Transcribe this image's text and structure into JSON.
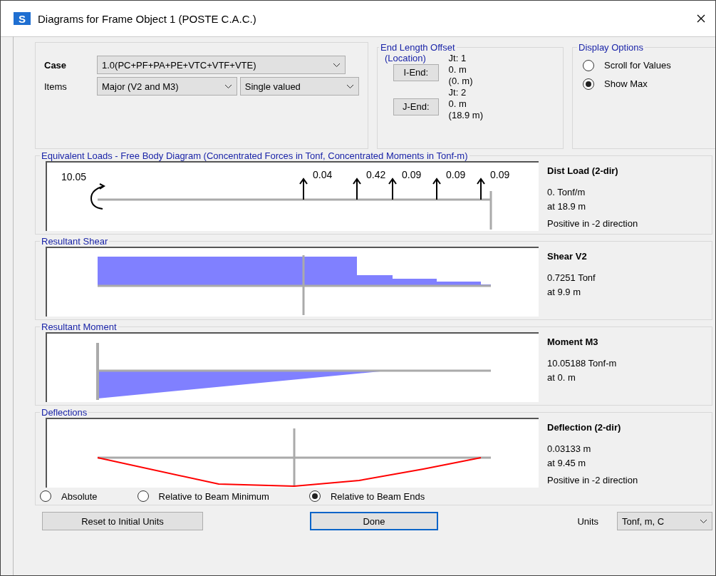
{
  "window": {
    "icon_letter": "S",
    "title": "Diagrams for Frame Object 1  (POSTE C.A.C.)"
  },
  "case_group": {
    "case_label": "Case",
    "case_value": "1.0(PC+PF+PA+PE+VTC+VTF+VTE)",
    "items_label": "Items",
    "items_value": "Major (V2 and M3)",
    "items_mode": "Single valued"
  },
  "end_offset": {
    "title": "End Length Offset",
    "subtitle": "(Location)",
    "ends": [
      {
        "button": "I-End:",
        "joint": "Jt:  1",
        "offset": "0. m",
        "location": "(0. m)"
      },
      {
        "button": "J-End:",
        "joint": "Jt:  2",
        "offset": "0. m",
        "location": "(18.9 m)"
      }
    ]
  },
  "display_options": {
    "title": "Display Options",
    "options": [
      {
        "label": "Scroll for Values",
        "selected": false
      },
      {
        "label": "Show Max",
        "selected": true
      }
    ]
  },
  "diagrams": [
    {
      "kind": "fbd",
      "title": "Equivalent Loads - Free Body Diagram  (Concentrated Forces in Tonf, Concentrated Moments in Tonf-m)",
      "moment_label": "10.05",
      "force_labels": [
        "0.04",
        "0.42",
        "0.09",
        "0.09",
        "0.09"
      ],
      "info_title": "Dist Load (2-dir)",
      "values": [
        "0. Tonf/m",
        "at 18.9 m"
      ],
      "note": "Positive in -2 direction"
    },
    {
      "kind": "shear",
      "title": "Resultant Shear",
      "info_title": "Shear V2",
      "values": [
        "0.7251 Tonf",
        "at 9.9 m"
      ]
    },
    {
      "kind": "moment",
      "title": "Resultant Moment",
      "info_title": "Moment M3",
      "values": [
        "10.05188 Tonf-m",
        "at 0. m"
      ]
    },
    {
      "kind": "deflection",
      "title": "Deflections",
      "info_title": "Deflection (2-dir)",
      "values": [
        "0.03133 m",
        "at 9.45 m"
      ],
      "note": "Positive in -2 direction"
    }
  ],
  "deflection_modes": [
    {
      "label": "Absolute",
      "selected": false
    },
    {
      "label": "Relative to Beam Minimum",
      "selected": false
    },
    {
      "label": "Relative to Beam Ends",
      "selected": true
    }
  ],
  "buttons": [
    {
      "kind": "plain",
      "label": "Reset to Initial Units"
    },
    {
      "kind": "default",
      "label": "Done"
    }
  ],
  "units": {
    "label": "Units",
    "value": "Tonf, m, C"
  }
}
